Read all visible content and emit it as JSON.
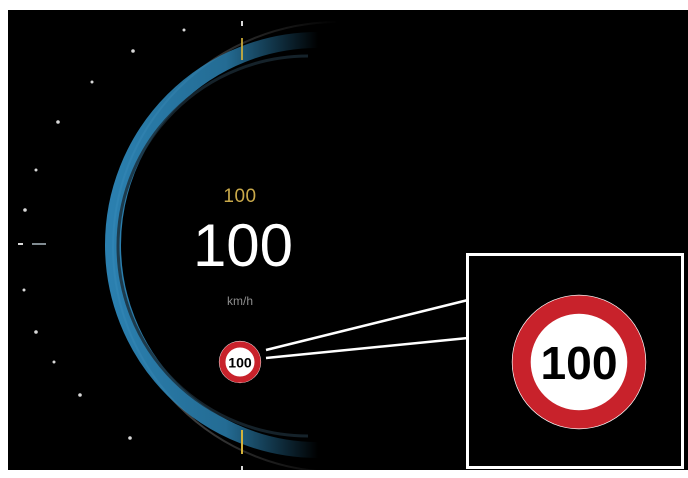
{
  "cluster": {
    "set_speed": "100",
    "current_speed": "100",
    "unit": "km/h"
  },
  "speed_limit_sign": {
    "value": "100",
    "icon": "speed-limit-sign-icon",
    "ring_color": "#c8222b",
    "face_color": "#ffffff",
    "text_color": "#000000"
  },
  "zoomed_sign": {
    "value": "100"
  },
  "colors": {
    "arc_blue": "#2a7fae",
    "set_speed_color": "#c9a94a",
    "marker_color": "#d4b23a"
  }
}
